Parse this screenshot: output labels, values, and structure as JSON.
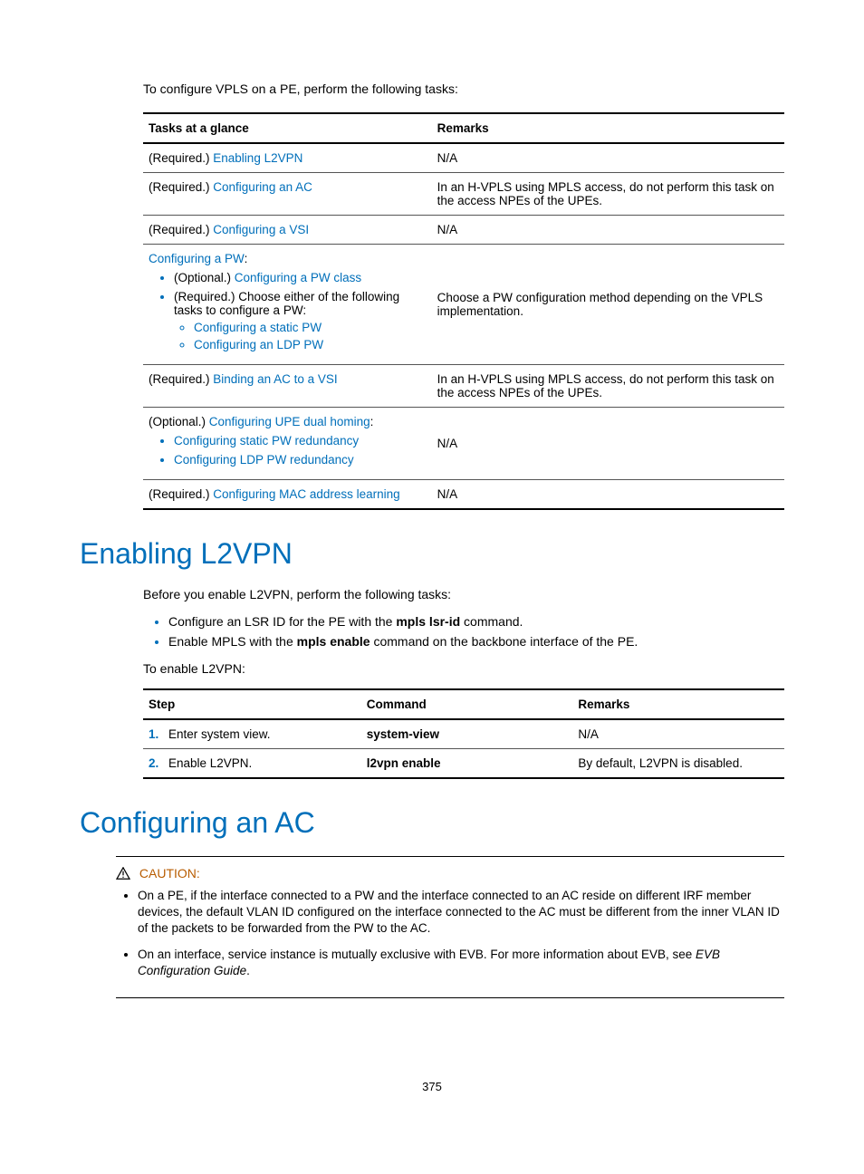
{
  "intro": "To configure VPLS on a PE, perform the following tasks:",
  "tasks_table": {
    "headers": {
      "col1": "Tasks at a glance",
      "col2": "Remarks"
    },
    "rows": {
      "r1": {
        "prefix": "(Required.) ",
        "link": "Enabling L2VPN",
        "remark": "N/A"
      },
      "r2": {
        "prefix": "(Required.) ",
        "link": "Configuring an AC",
        "remark": "In an H-VPLS using MPLS access, do not perform this task on the access NPEs of the UPEs."
      },
      "r3": {
        "prefix": "(Required.) ",
        "link": "Configuring a VSI",
        "remark": "N/A"
      },
      "r4": {
        "top_link": "Configuring a PW",
        "bullet1_prefix": "(Optional.) ",
        "bullet1_link": "Configuring a PW class",
        "bullet2_text": "(Required.) Choose either of the following tasks to configure a PW:",
        "sub1_link": "Configuring a static PW",
        "sub2_link": "Configuring an LDP PW",
        "remark": "Choose a PW configuration method depending on the VPLS implementation."
      },
      "r5": {
        "prefix": "(Required.) ",
        "link": "Binding an AC to a VSI",
        "remark": "In an H-VPLS using MPLS access, do not perform this task on the access NPEs of the UPEs."
      },
      "r6": {
        "prefix": "(Optional.) ",
        "link": "Configuring UPE dual homing",
        "sub1_link": "Configuring static PW redundancy",
        "sub2_link": "Configuring LDP PW redundancy",
        "remark": "N/A"
      },
      "r7": {
        "prefix": "(Required.) ",
        "link": "Configuring MAC address learning",
        "remark": "N/A"
      }
    }
  },
  "section1": {
    "heading": "Enabling L2VPN",
    "intro": "Before you enable L2VPN, perform the following tasks:",
    "bullet1_pre": "Configure an LSR ID for the PE with the ",
    "bullet1_bold": "mpls lsr-id",
    "bullet1_post": " command.",
    "bullet2_pre": "Enable MPLS with the ",
    "bullet2_bold": "mpls enable",
    "bullet2_post": " command on the backbone interface of the PE.",
    "intro2": "To enable L2VPN:"
  },
  "steps_table": {
    "headers": {
      "c1": "Step",
      "c2": "Command",
      "c3": "Remarks"
    },
    "rows": {
      "s1": {
        "num": "1.",
        "step": "Enter system view.",
        "cmd": "system-view",
        "remark": "N/A"
      },
      "s2": {
        "num": "2.",
        "step": "Enable L2VPN.",
        "cmd": "l2vpn enable",
        "remark": "By default, L2VPN is disabled."
      }
    }
  },
  "section2": {
    "heading": "Configuring an AC",
    "caution_label": "CAUTION:",
    "caution1": "On a PE, if the interface connected to a PW and the interface connected to an AC reside on different IRF member devices, the default VLAN ID configured on the interface connected to the AC must be different from the inner VLAN ID of the packets to be forwarded from the PW to the AC.",
    "caution2_pre": "On an interface, service instance is mutually exclusive with EVB. For more information about EVB, see ",
    "caution2_italic": "EVB Configuration Guide",
    "caution2_post": "."
  },
  "page_number": "375"
}
